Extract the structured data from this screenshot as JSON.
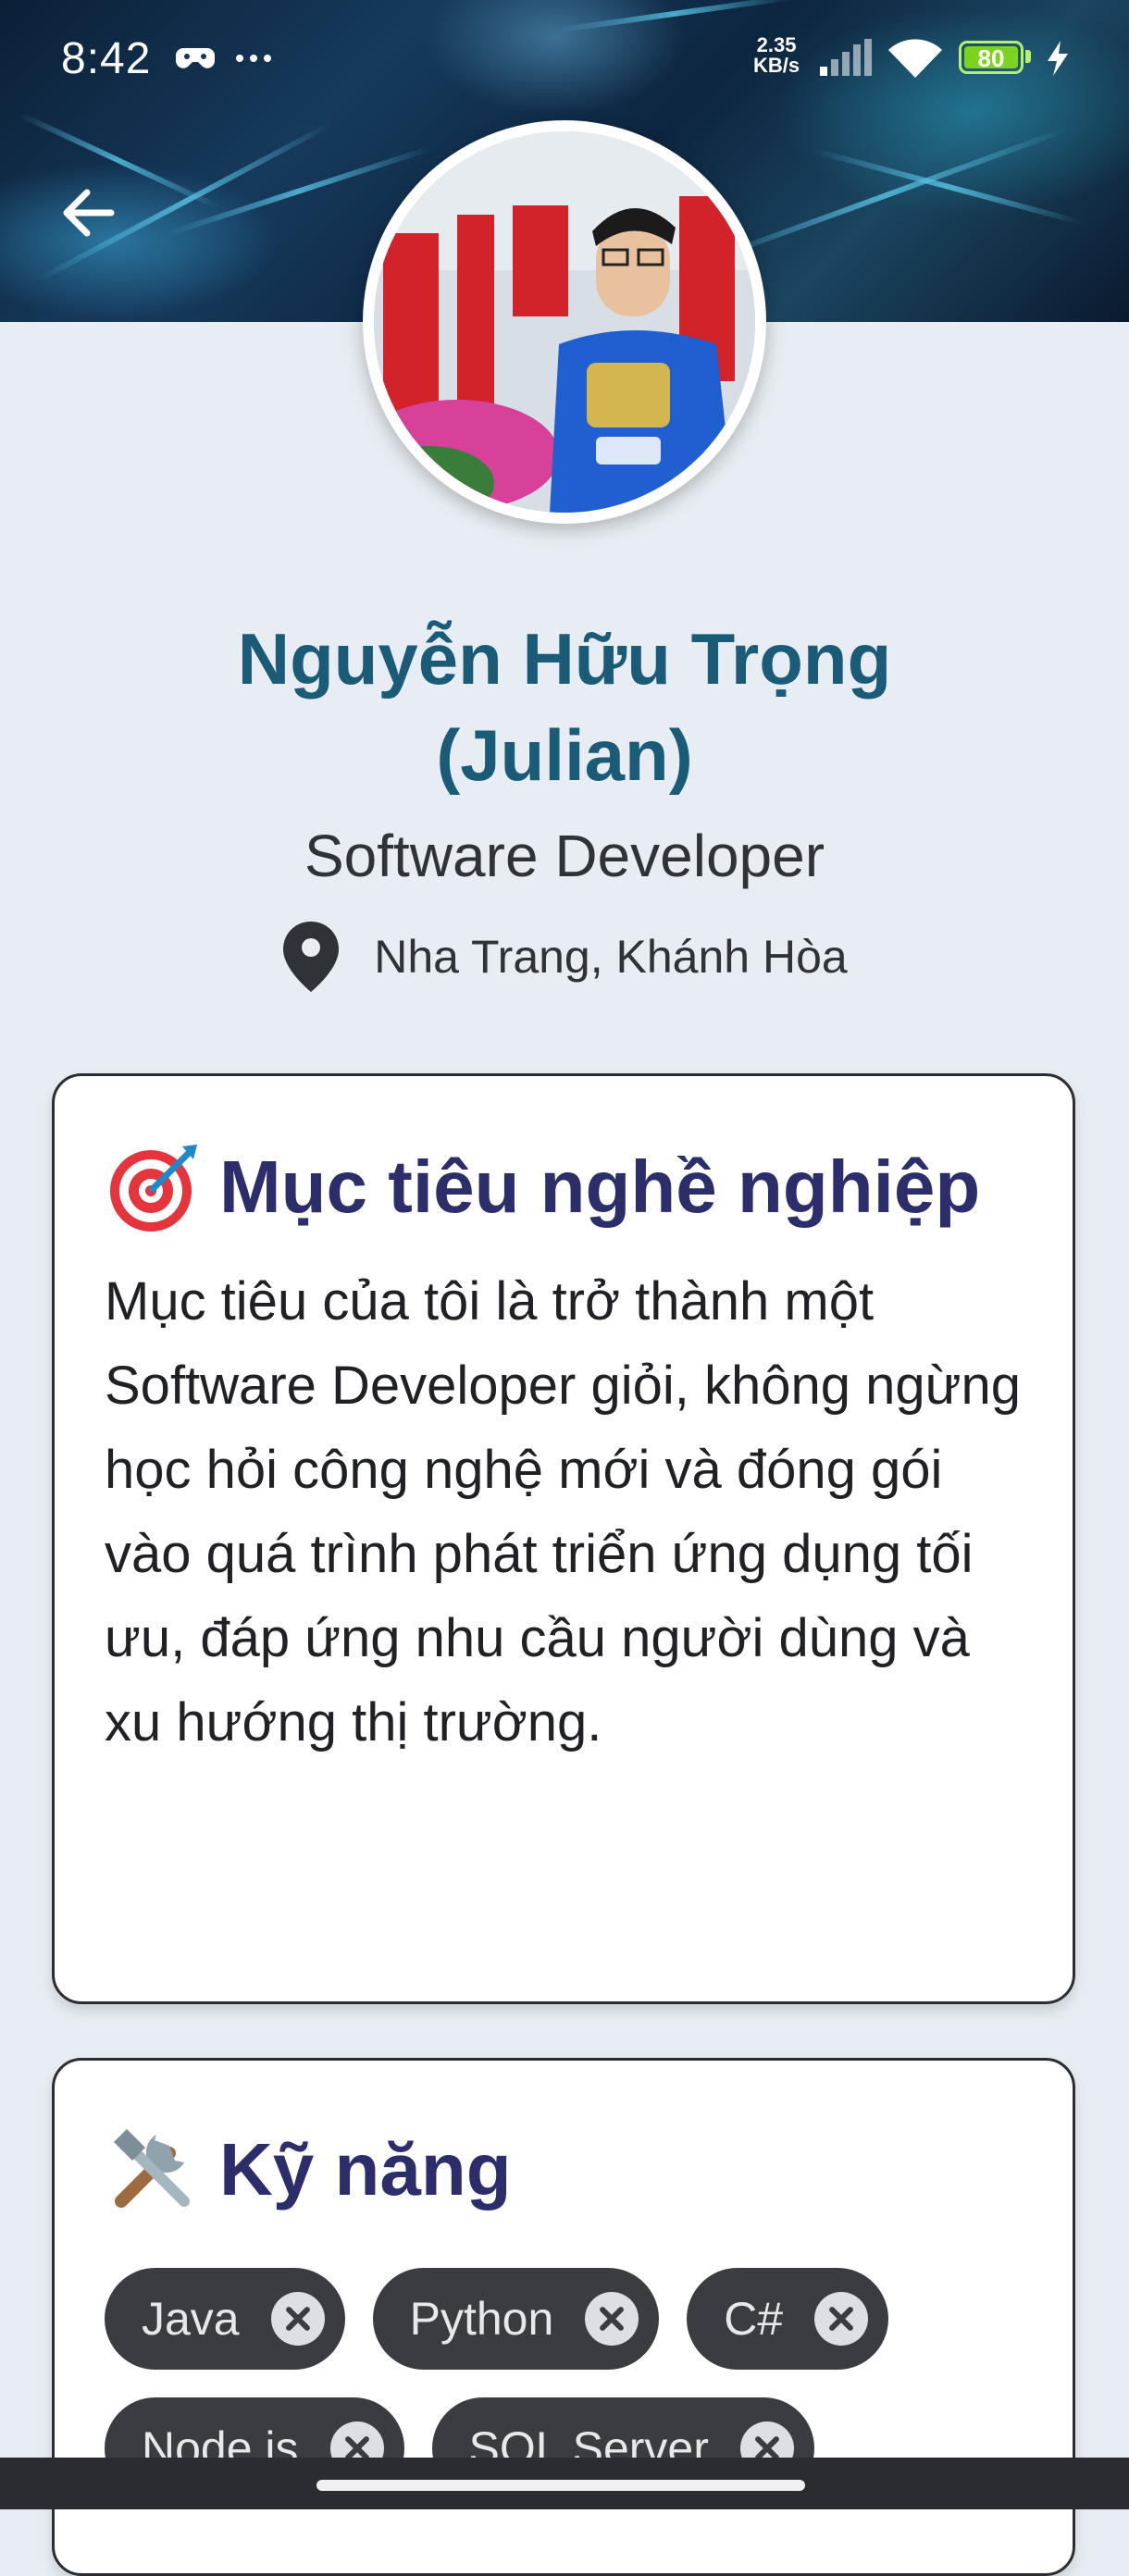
{
  "status_bar": {
    "time": "8:42",
    "net_speed_value": "2.35",
    "net_speed_unit": "KB/s",
    "battery": "80",
    "icons": [
      "game-controller-icon",
      "more-dots-icon",
      "signal-icon",
      "wifi-icon",
      "battery-icon",
      "charging-icon"
    ]
  },
  "header": {
    "back_icon": "arrow-left-icon"
  },
  "profile": {
    "name": "Nguyễn Hữu Trọng (Julian)",
    "role": "Software Developer",
    "location": "Nha Trang, Khánh Hòa",
    "location_icon": "map-pin-icon"
  },
  "goal_card": {
    "icon": "target-emoji",
    "title": "Mục tiêu nghề nghiệp",
    "body": "Mục tiêu của tôi là trở thành một Software Developer giỏi, không ngừng học hỏi công nghệ mới và đóng gói vào quá trình phát triển ứng dụng tối ưu, đáp ứng nhu cầu người dùng và xu hướng thị trường."
  },
  "skills_card": {
    "icon": "tools-emoji",
    "title": "Kỹ năng",
    "skills": [
      "Java",
      "Python",
      "C#",
      "Node.js",
      "SQL Server"
    ]
  },
  "colors": {
    "name": "#1a5b77",
    "card_title": "#2b2e6b",
    "chip_bg": "#3a3c41",
    "page_bg": "#e7edf2"
  }
}
